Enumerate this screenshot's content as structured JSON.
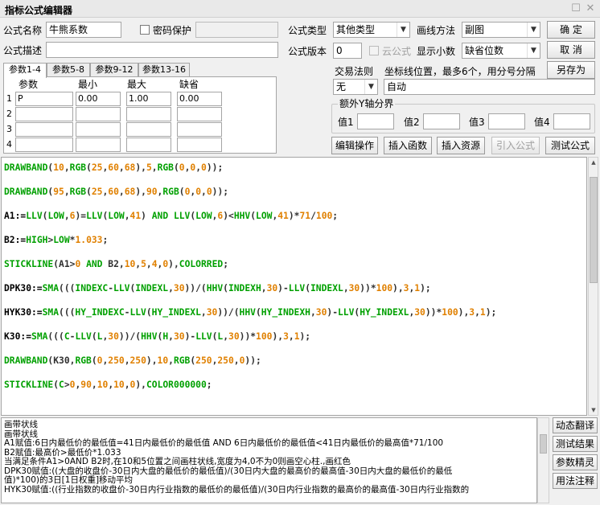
{
  "window": {
    "title": "指标公式编辑器"
  },
  "form": {
    "name_label": "公式名称",
    "name_value": "牛熊系数",
    "password_label": "密码保护",
    "desc_label": "公式描述",
    "desc_value": "",
    "type_label": "公式类型",
    "type_value": "其他类型",
    "draw_label": "画线方法",
    "draw_value": "副图",
    "version_label": "公式版本",
    "version_value": "0",
    "cloud_label": "云公式",
    "decimal_label": "显示小数",
    "decimal_value": "缺省位数",
    "trade_label": "交易法则",
    "trade_value": "无",
    "coord_label": "坐标线位置，最多6个，用分号分隔",
    "coord_value": "自动",
    "extra_y_label": "额外Y轴分界",
    "y_labels": [
      "值1",
      "值2",
      "值3",
      "值4"
    ]
  },
  "buttons": {
    "ok": "确  定",
    "cancel": "取  消",
    "save_as": "另存为",
    "edit_op": "编辑操作",
    "insert_func": "插入函数",
    "insert_res": "插入资源",
    "import_formula": "引入公式",
    "test_formula": "测试公式",
    "dyn_translate": "动态翻译",
    "test_result": "测试结果",
    "param_guide": "参数精灵",
    "usage_note": "用法注释"
  },
  "tabs": [
    "参数1-4",
    "参数5-8",
    "参数9-12",
    "参数13-16"
  ],
  "param_table": {
    "headers": [
      "参数",
      "最小",
      "最大",
      "缺省"
    ],
    "rows": [
      {
        "n": "1",
        "name": "P",
        "min": "0.00",
        "max": "1.00",
        "def": "0.00"
      },
      {
        "n": "2",
        "name": "",
        "min": "",
        "max": "",
        "def": ""
      },
      {
        "n": "3",
        "name": "",
        "min": "",
        "max": "",
        "def": ""
      },
      {
        "n": "4",
        "name": "",
        "min": "",
        "max": "",
        "def": ""
      }
    ]
  },
  "code": [
    [
      [
        "g",
        "DRAWBAND"
      ],
      [
        "p",
        "("
      ],
      [
        "o",
        "10"
      ],
      [
        "p",
        ","
      ],
      [
        "g",
        "RGB"
      ],
      [
        "p",
        "("
      ],
      [
        "o",
        "25"
      ],
      [
        "p",
        ","
      ],
      [
        "o",
        "60"
      ],
      [
        "p",
        ","
      ],
      [
        "o",
        "68"
      ],
      [
        "p",
        "),"
      ],
      [
        "o",
        "5"
      ],
      [
        "p",
        ","
      ],
      [
        "g",
        "RGB"
      ],
      [
        "p",
        "("
      ],
      [
        "o",
        "0"
      ],
      [
        "p",
        ","
      ],
      [
        "o",
        "0"
      ],
      [
        "p",
        ","
      ],
      [
        "o",
        "0"
      ],
      [
        "p",
        "));"
      ]
    ],
    [
      [
        "g",
        "DRAWBAND"
      ],
      [
        "p",
        "("
      ],
      [
        "o",
        "95"
      ],
      [
        "p",
        ","
      ],
      [
        "g",
        "RGB"
      ],
      [
        "p",
        "("
      ],
      [
        "o",
        "25"
      ],
      [
        "p",
        ","
      ],
      [
        "o",
        "60"
      ],
      [
        "p",
        ","
      ],
      [
        "o",
        "68"
      ],
      [
        "p",
        "),"
      ],
      [
        "o",
        "90"
      ],
      [
        "p",
        ","
      ],
      [
        "g",
        "RGB"
      ],
      [
        "p",
        "("
      ],
      [
        "o",
        "0"
      ],
      [
        "p",
        ","
      ],
      [
        "o",
        "0"
      ],
      [
        "p",
        ","
      ],
      [
        "o",
        "0"
      ],
      [
        "p",
        "));"
      ]
    ],
    [
      [
        "b",
        "A1:="
      ],
      [
        "g",
        "LLV"
      ],
      [
        "p",
        "("
      ],
      [
        "g",
        "LOW"
      ],
      [
        "p",
        ","
      ],
      [
        "o",
        "6"
      ],
      [
        "p",
        ")="
      ],
      [
        "g",
        "LLV"
      ],
      [
        "p",
        "("
      ],
      [
        "g",
        "LOW"
      ],
      [
        "p",
        ","
      ],
      [
        "o",
        "41"
      ],
      [
        "p",
        ") "
      ],
      [
        "g",
        "AND"
      ],
      [
        "p",
        " "
      ],
      [
        "g",
        "LLV"
      ],
      [
        "p",
        "("
      ],
      [
        "g",
        "LOW"
      ],
      [
        "p",
        ","
      ],
      [
        "o",
        "6"
      ],
      [
        "p",
        ")<"
      ],
      [
        "g",
        "HHV"
      ],
      [
        "p",
        "("
      ],
      [
        "g",
        "LOW"
      ],
      [
        "p",
        ","
      ],
      [
        "o",
        "41"
      ],
      [
        "p",
        ")*"
      ],
      [
        "o",
        "71"
      ],
      [
        "p",
        "/"
      ],
      [
        "o",
        "100"
      ],
      [
        "p",
        ";"
      ]
    ],
    [
      [
        "b",
        "B2:="
      ],
      [
        "g",
        "HIGH"
      ],
      [
        "p",
        ">"
      ],
      [
        "g",
        "LOW"
      ],
      [
        "p",
        "*"
      ],
      [
        "o",
        "1.033"
      ],
      [
        "p",
        ";"
      ]
    ],
    [
      [
        "g",
        "STICKLINE"
      ],
      [
        "p",
        "(A1>"
      ],
      [
        "o",
        "0"
      ],
      [
        "p",
        " "
      ],
      [
        "g",
        "AND"
      ],
      [
        "p",
        " B2,"
      ],
      [
        "o",
        "10"
      ],
      [
        "p",
        ","
      ],
      [
        "o",
        "5"
      ],
      [
        "p",
        ","
      ],
      [
        "o",
        "4"
      ],
      [
        "p",
        ","
      ],
      [
        "o",
        "0"
      ],
      [
        "p",
        "),"
      ],
      [
        "g",
        "COLORRED"
      ],
      [
        "p",
        ";"
      ]
    ],
    [
      [
        "b",
        "DPK30:="
      ],
      [
        "g",
        "SMA"
      ],
      [
        "p",
        "((("
      ],
      [
        "g",
        "INDEXC"
      ],
      [
        "p",
        "-"
      ],
      [
        "g",
        "LLV"
      ],
      [
        "p",
        "("
      ],
      [
        "g",
        "INDEXL"
      ],
      [
        "p",
        ","
      ],
      [
        "o",
        "30"
      ],
      [
        "p",
        "))/("
      ],
      [
        "g",
        "HHV"
      ],
      [
        "p",
        "("
      ],
      [
        "g",
        "INDEXH"
      ],
      [
        "p",
        ","
      ],
      [
        "o",
        "30"
      ],
      [
        "p",
        ")-"
      ],
      [
        "g",
        "LLV"
      ],
      [
        "p",
        "("
      ],
      [
        "g",
        "INDEXL"
      ],
      [
        "p",
        ","
      ],
      [
        "o",
        "30"
      ],
      [
        "p",
        "))*"
      ],
      [
        "o",
        "100"
      ],
      [
        "p",
        "),"
      ],
      [
        "o",
        "3"
      ],
      [
        "p",
        ","
      ],
      [
        "o",
        "1"
      ],
      [
        "p",
        ");"
      ]
    ],
    [
      [
        "b",
        "HYK30:="
      ],
      [
        "g",
        "SMA"
      ],
      [
        "p",
        "((("
      ],
      [
        "g",
        "HY_INDEXC"
      ],
      [
        "p",
        "-"
      ],
      [
        "g",
        "LLV"
      ],
      [
        "p",
        "("
      ],
      [
        "g",
        "HY_INDEXL"
      ],
      [
        "p",
        ","
      ],
      [
        "o",
        "30"
      ],
      [
        "p",
        "))/("
      ],
      [
        "g",
        "HHV"
      ],
      [
        "p",
        "("
      ],
      [
        "g",
        "HY_INDEXH"
      ],
      [
        "p",
        ","
      ],
      [
        "o",
        "30"
      ],
      [
        "p",
        ")-"
      ],
      [
        "g",
        "LLV"
      ],
      [
        "p",
        "("
      ],
      [
        "g",
        "HY_INDEXL"
      ],
      [
        "p",
        ","
      ],
      [
        "o",
        "30"
      ],
      [
        "p",
        "))*"
      ],
      [
        "o",
        "100"
      ],
      [
        "p",
        "),"
      ],
      [
        "o",
        "3"
      ],
      [
        "p",
        ","
      ],
      [
        "o",
        "1"
      ],
      [
        "p",
        ");"
      ]
    ],
    [
      [
        "b",
        "K30:="
      ],
      [
        "g",
        "SMA"
      ],
      [
        "p",
        "((("
      ],
      [
        "g",
        "C"
      ],
      [
        "p",
        "-"
      ],
      [
        "g",
        "LLV"
      ],
      [
        "p",
        "("
      ],
      [
        "g",
        "L"
      ],
      [
        "p",
        ","
      ],
      [
        "o",
        "30"
      ],
      [
        "p",
        "))/("
      ],
      [
        "g",
        "HHV"
      ],
      [
        "p",
        "("
      ],
      [
        "g",
        "H"
      ],
      [
        "p",
        ","
      ],
      [
        "o",
        "30"
      ],
      [
        "p",
        ")-"
      ],
      [
        "g",
        "LLV"
      ],
      [
        "p",
        "("
      ],
      [
        "g",
        "L"
      ],
      [
        "p",
        ","
      ],
      [
        "o",
        "30"
      ],
      [
        "p",
        "))*"
      ],
      [
        "o",
        "100"
      ],
      [
        "p",
        "),"
      ],
      [
        "o",
        "3"
      ],
      [
        "p",
        ","
      ],
      [
        "o",
        "1"
      ],
      [
        "p",
        ");"
      ]
    ],
    [
      [
        "g",
        "DRAWBAND"
      ],
      [
        "p",
        "(K30,"
      ],
      [
        "g",
        "RGB"
      ],
      [
        "p",
        "("
      ],
      [
        "o",
        "0"
      ],
      [
        "p",
        ","
      ],
      [
        "o",
        "250"
      ],
      [
        "p",
        ","
      ],
      [
        "o",
        "250"
      ],
      [
        "p",
        "),"
      ],
      [
        "o",
        "10"
      ],
      [
        "p",
        ","
      ],
      [
        "g",
        "RGB"
      ],
      [
        "p",
        "("
      ],
      [
        "o",
        "250"
      ],
      [
        "p",
        ","
      ],
      [
        "o",
        "250"
      ],
      [
        "p",
        ","
      ],
      [
        "o",
        "0"
      ],
      [
        "p",
        "));"
      ]
    ],
    [
      [
        "g",
        "STICKLINE"
      ],
      [
        "p",
        "("
      ],
      [
        "g",
        "C"
      ],
      [
        "p",
        ">"
      ],
      [
        "o",
        "0"
      ],
      [
        "p",
        ","
      ],
      [
        "o",
        "90"
      ],
      [
        "p",
        ","
      ],
      [
        "o",
        "10"
      ],
      [
        "p",
        ","
      ],
      [
        "o",
        "10"
      ],
      [
        "p",
        ","
      ],
      [
        "o",
        "0"
      ],
      [
        "p",
        "),"
      ],
      [
        "g",
        "COLOR000000"
      ],
      [
        "p",
        ";"
      ]
    ]
  ],
  "explain": [
    "画带状线",
    "画带状线",
    "A1赋值:6日内最低价的最低值=41日内最低价的最低值 AND 6日内最低价的最低值<41日内最低价的最高值*71/100",
    "B2赋值:最高价>最低价*1.033",
    "当满足条件A1>0AND B2时,在10和5位置之间画柱状线,宽度为4,0不为0则画空心柱.,画红色",
    "DPK30赋值:((大盘的收盘价-30日内大盘的最低价的最低值)/(30日内大盘的最高价的最高值-30日内大盘的最低价的最低",
    "值)*100)的3日[1日权重]移动平均",
    "HYK30赋值:((行业指数的收盘价-30日内行业指数的最低价的最低值)/(30日内行业指数的最高价的最高值-30日内行业指数的"
  ]
}
